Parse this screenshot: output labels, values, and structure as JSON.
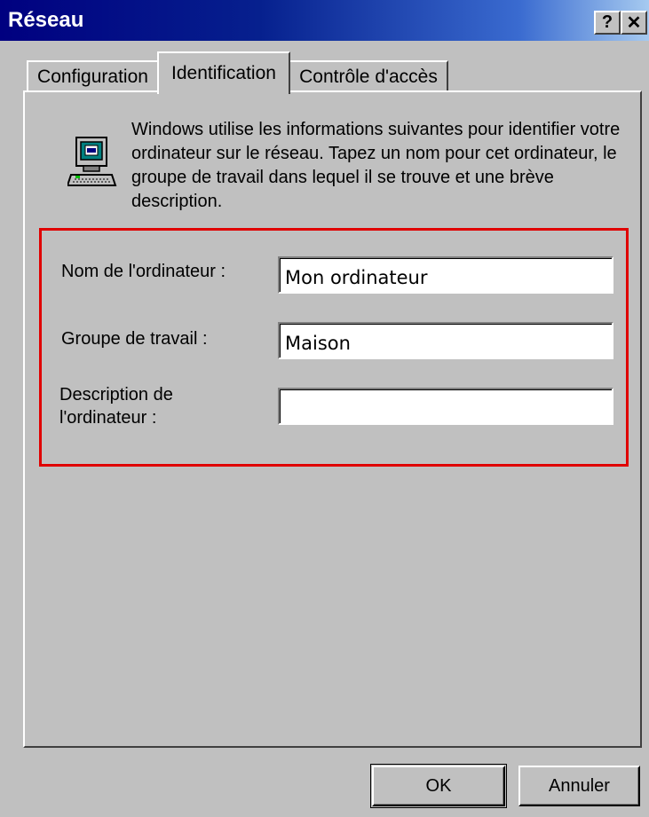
{
  "window": {
    "title": "Réseau",
    "help_button": "?",
    "close_button": "✕"
  },
  "tabs": [
    {
      "label": "Configuration",
      "active": false
    },
    {
      "label": "Identification",
      "active": true
    },
    {
      "label": "Contrôle d'accès",
      "active": false
    }
  ],
  "identification": {
    "intro_text": "Windows utilise les informations suivantes pour identifier votre ordinateur sur le réseau. Tapez un nom pour cet ordinateur, le groupe de travail dans lequel il se trouve et une brève description.",
    "icon": "computer-icon",
    "fields": {
      "computer_name": {
        "label": "Nom de l'ordinateur :",
        "value": "Mon ordinateur"
      },
      "workgroup": {
        "label": "Groupe de travail :",
        "value": "Maison"
      },
      "description": {
        "label_line1": "Description de",
        "label_line2": "l'ordinateur :",
        "value": ""
      }
    },
    "highlight_color": "#e00000"
  },
  "buttons": {
    "ok": "OK",
    "cancel": "Annuler"
  },
  "colors": {
    "face": "#c0c0c0",
    "title_start": "#000080",
    "title_end": "#a6caf0"
  }
}
